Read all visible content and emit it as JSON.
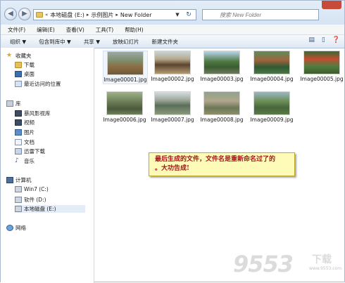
{
  "address": {
    "segments": [
      "本地磁盘 (E:)",
      "示例图片",
      "New Folder"
    ],
    "search_placeholder": "搜索 New Folder"
  },
  "menu": [
    "文件(F)",
    "编辑(E)",
    "查看(V)",
    "工具(T)",
    "帮助(H)"
  ],
  "toolbar": {
    "organize": "组织 ▼",
    "include_library": "包含到库中 ▼",
    "share": "共享 ▼",
    "slideshow": "放映幻灯片",
    "new_folder": "新建文件夹"
  },
  "nav": {
    "favorites": "收藏夹",
    "downloads": "下载",
    "desktop": "桌面",
    "recent": "最近访问的位置",
    "libraries": "库",
    "storm_video": "暴风影视库",
    "videos": "视频",
    "pictures": "图片",
    "documents": "文档",
    "thunder": "迅雷下载",
    "music": "音乐",
    "computer": "计算机",
    "drive_c": "Win7 (C:)",
    "drive_d": "软件 (D:)",
    "drive_e": "本地磁盘 (E:)",
    "network": "网络"
  },
  "files": [
    {
      "name": "Image00001.jpg"
    },
    {
      "name": "Image00002.jpg"
    },
    {
      "name": "Image00003.jpg"
    },
    {
      "name": "Image00004.jpg"
    },
    {
      "name": "Image00005.jpg"
    },
    {
      "name": "Image00006.jpg"
    },
    {
      "name": "Image00007.jpg"
    },
    {
      "name": "Image00008.jpg"
    },
    {
      "name": "Image00009.jpg"
    }
  ],
  "callout": {
    "line1": "最后生成的文件，文件名是重新命名过了的",
    "line2": "。大功告成!"
  },
  "watermark": {
    "main": "9553",
    "sub": "下载",
    "url": "www.9553.com"
  }
}
